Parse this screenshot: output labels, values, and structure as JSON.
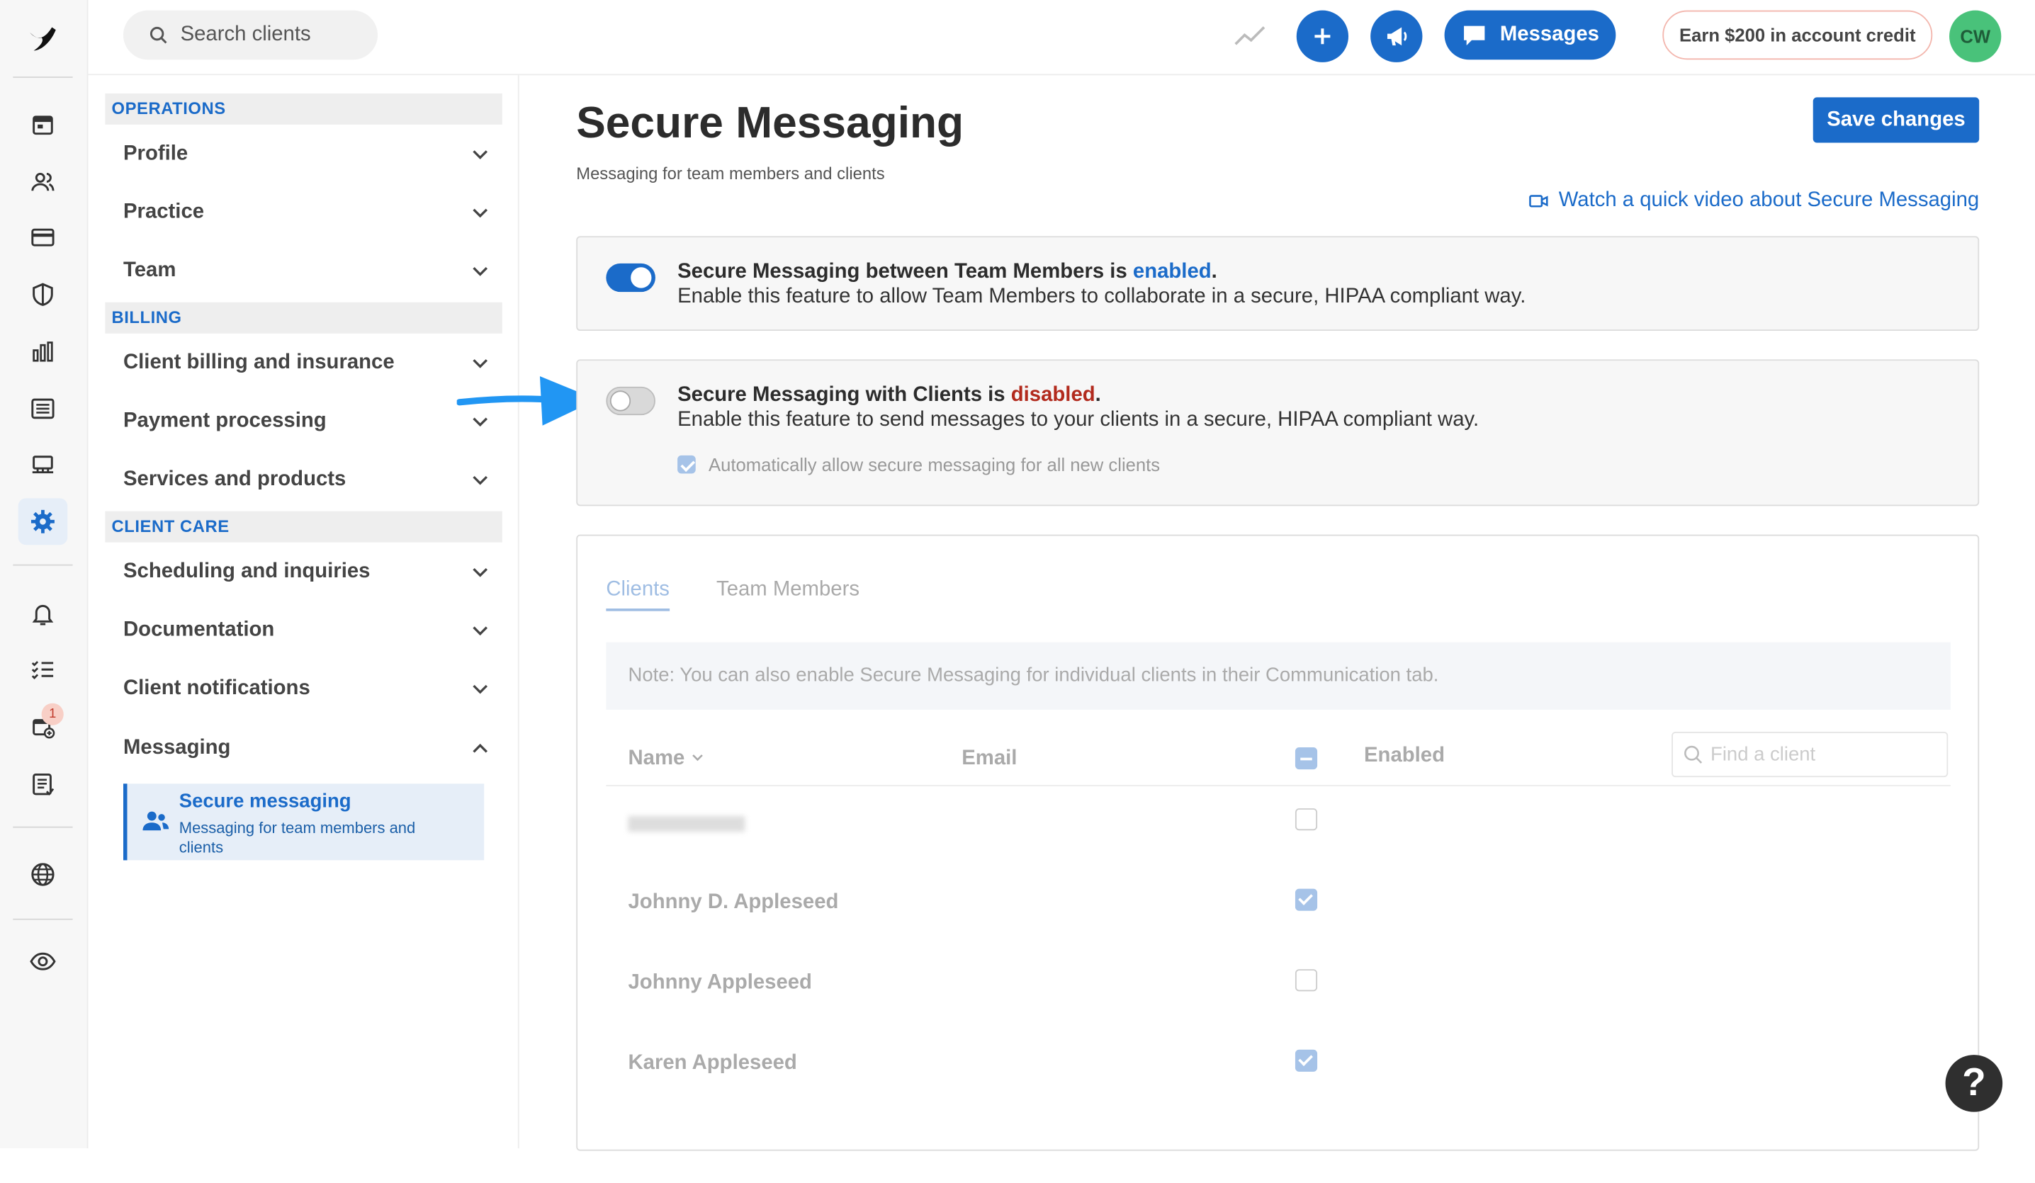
{
  "topbar": {
    "search_placeholder": "Search clients",
    "messages_label": "Messages",
    "earn_label": "Earn $200 in account credit",
    "avatar_initials": "CW"
  },
  "sidebar": {
    "sections": [
      {
        "title": "OPERATIONS",
        "items": [
          "Profile",
          "Practice",
          "Team"
        ]
      },
      {
        "title": "BILLING",
        "items": [
          "Client billing and insurance",
          "Payment processing",
          "Services and products"
        ]
      },
      {
        "title": "CLIENT CARE",
        "items": [
          "Scheduling and inquiries",
          "Documentation",
          "Client notifications",
          "Messaging"
        ]
      }
    ],
    "active_sub": {
      "title": "Secure messaging",
      "desc": "Messaging for team members and clients"
    }
  },
  "rail": {
    "notification_badge": "1"
  },
  "page": {
    "title": "Secure Messaging",
    "subtitle": "Messaging for team members and clients",
    "save_label": "Save changes",
    "video_link": "Watch a quick video about Secure Messaging"
  },
  "team_card": {
    "title_prefix": "Secure Messaging between Team Members is",
    "status": "enabled",
    "desc": "Enable this feature to allow Team Members to collaborate in a secure, HIPAA compliant way.",
    "toggle_on": true
  },
  "client_card": {
    "title_prefix": "Secure Messaging with Clients is",
    "status": "disabled",
    "desc": "Enable this feature to send messages to your clients in a secure, HIPAA compliant way.",
    "auto_label": "Automatically allow secure messaging for all new clients",
    "auto_checked": true,
    "toggle_on": false
  },
  "panel": {
    "tabs": [
      "Clients",
      "Team Members"
    ],
    "note": "Note: You can also enable Secure Messaging for individual clients in their Communication tab.",
    "columns": {
      "name": "Name",
      "email": "Email",
      "enabled": "Enabled"
    },
    "find_placeholder": "Find a client",
    "rows": [
      {
        "name": "",
        "enabled": false
      },
      {
        "name": "Johnny D. Appleseed",
        "enabled": true
      },
      {
        "name": "Johnny Appleseed",
        "enabled": false
      },
      {
        "name": "Karen Appleseed",
        "enabled": true
      }
    ]
  },
  "help_label": "?"
}
